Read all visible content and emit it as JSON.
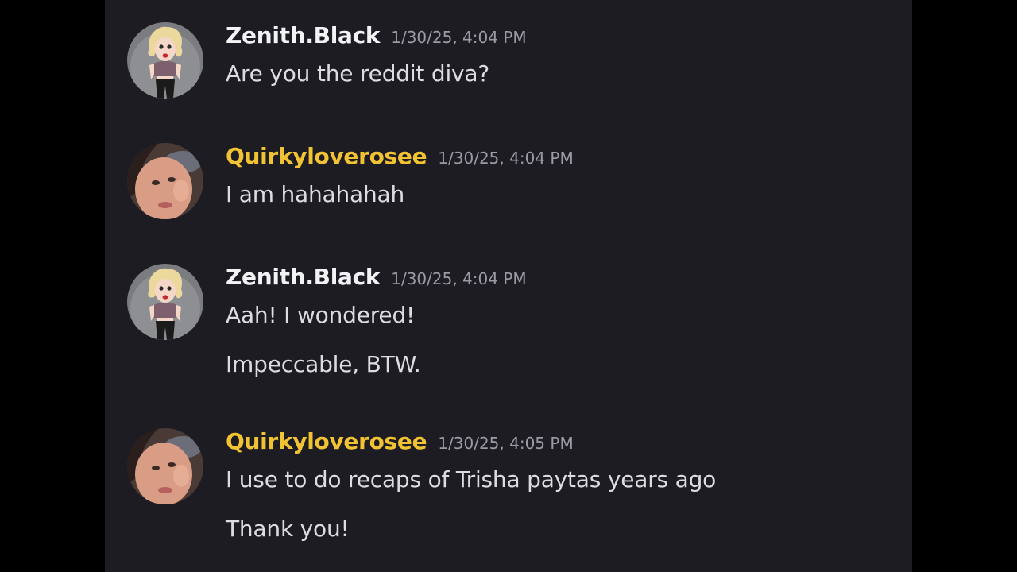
{
  "theme": {
    "frame_bg": "#000000",
    "chat_bg": "#1c1c22",
    "text": "#dcdde0",
    "timestamp": "#9a9ba3",
    "user_colors": {
      "zenith": "#f2f3f5",
      "quirky": "#f1c232"
    }
  },
  "messages": [
    {
      "username": "Zenith.Black",
      "timestamp": "1/30/25, 4:04 PM",
      "avatar": "cartoon-blonde-avatar-icon",
      "lines": [
        "Are you the reddit diva?"
      ]
    },
    {
      "username": "Quirkyloverosee",
      "timestamp": "1/30/25, 4:04 PM",
      "avatar": "selfie-photo-avatar",
      "lines": [
        "I am hahahahah"
      ]
    },
    {
      "username": "Zenith.Black",
      "timestamp": "1/30/25, 4:04 PM",
      "avatar": "cartoon-blonde-avatar-icon",
      "lines": [
        "Aah! I wondered!",
        "Impeccable, BTW."
      ]
    },
    {
      "username": "Quirkyloverosee",
      "timestamp": "1/30/25, 4:05 PM",
      "avatar": "selfie-photo-avatar",
      "lines": [
        "I use to do recaps of Trisha paytas years ago",
        "Thank you!"
      ]
    }
  ]
}
